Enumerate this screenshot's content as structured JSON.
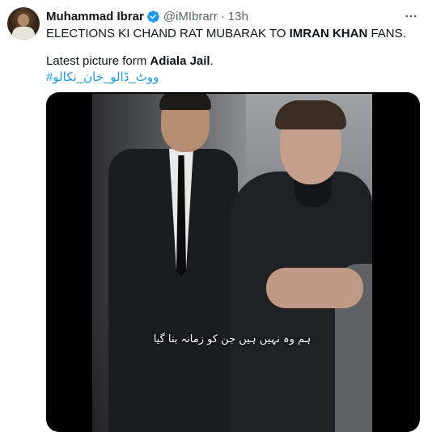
{
  "tweet": {
    "author_name": "Muhammad Ibrar",
    "handle": "@iMIbrarr",
    "separator": "·",
    "time": "13h",
    "more_label": "⋯",
    "line1": {
      "prefix": "ELECTIONS KI CHAND RAT MUBARAK TO ",
      "bold": "IMRAN KHAN",
      "suffix": " FANS."
    },
    "line2": {
      "prefix": "Latest picture form ",
      "bold": "Adiala Jail",
      "suffix": "."
    },
    "hashtag": "#ووٹ_ڈالو_خان_نکالو",
    "media": {
      "caption": "ہم وہ نہیں ہیں جن کو زمانہ بنا گیا"
    }
  },
  "colors": {
    "link": "#1d9bf0",
    "text": "#0f1419",
    "secondary": "#536471",
    "media_bg": "#000000"
  },
  "icons": {
    "verified": "verified-badge-icon",
    "more": "more-options-icon"
  }
}
